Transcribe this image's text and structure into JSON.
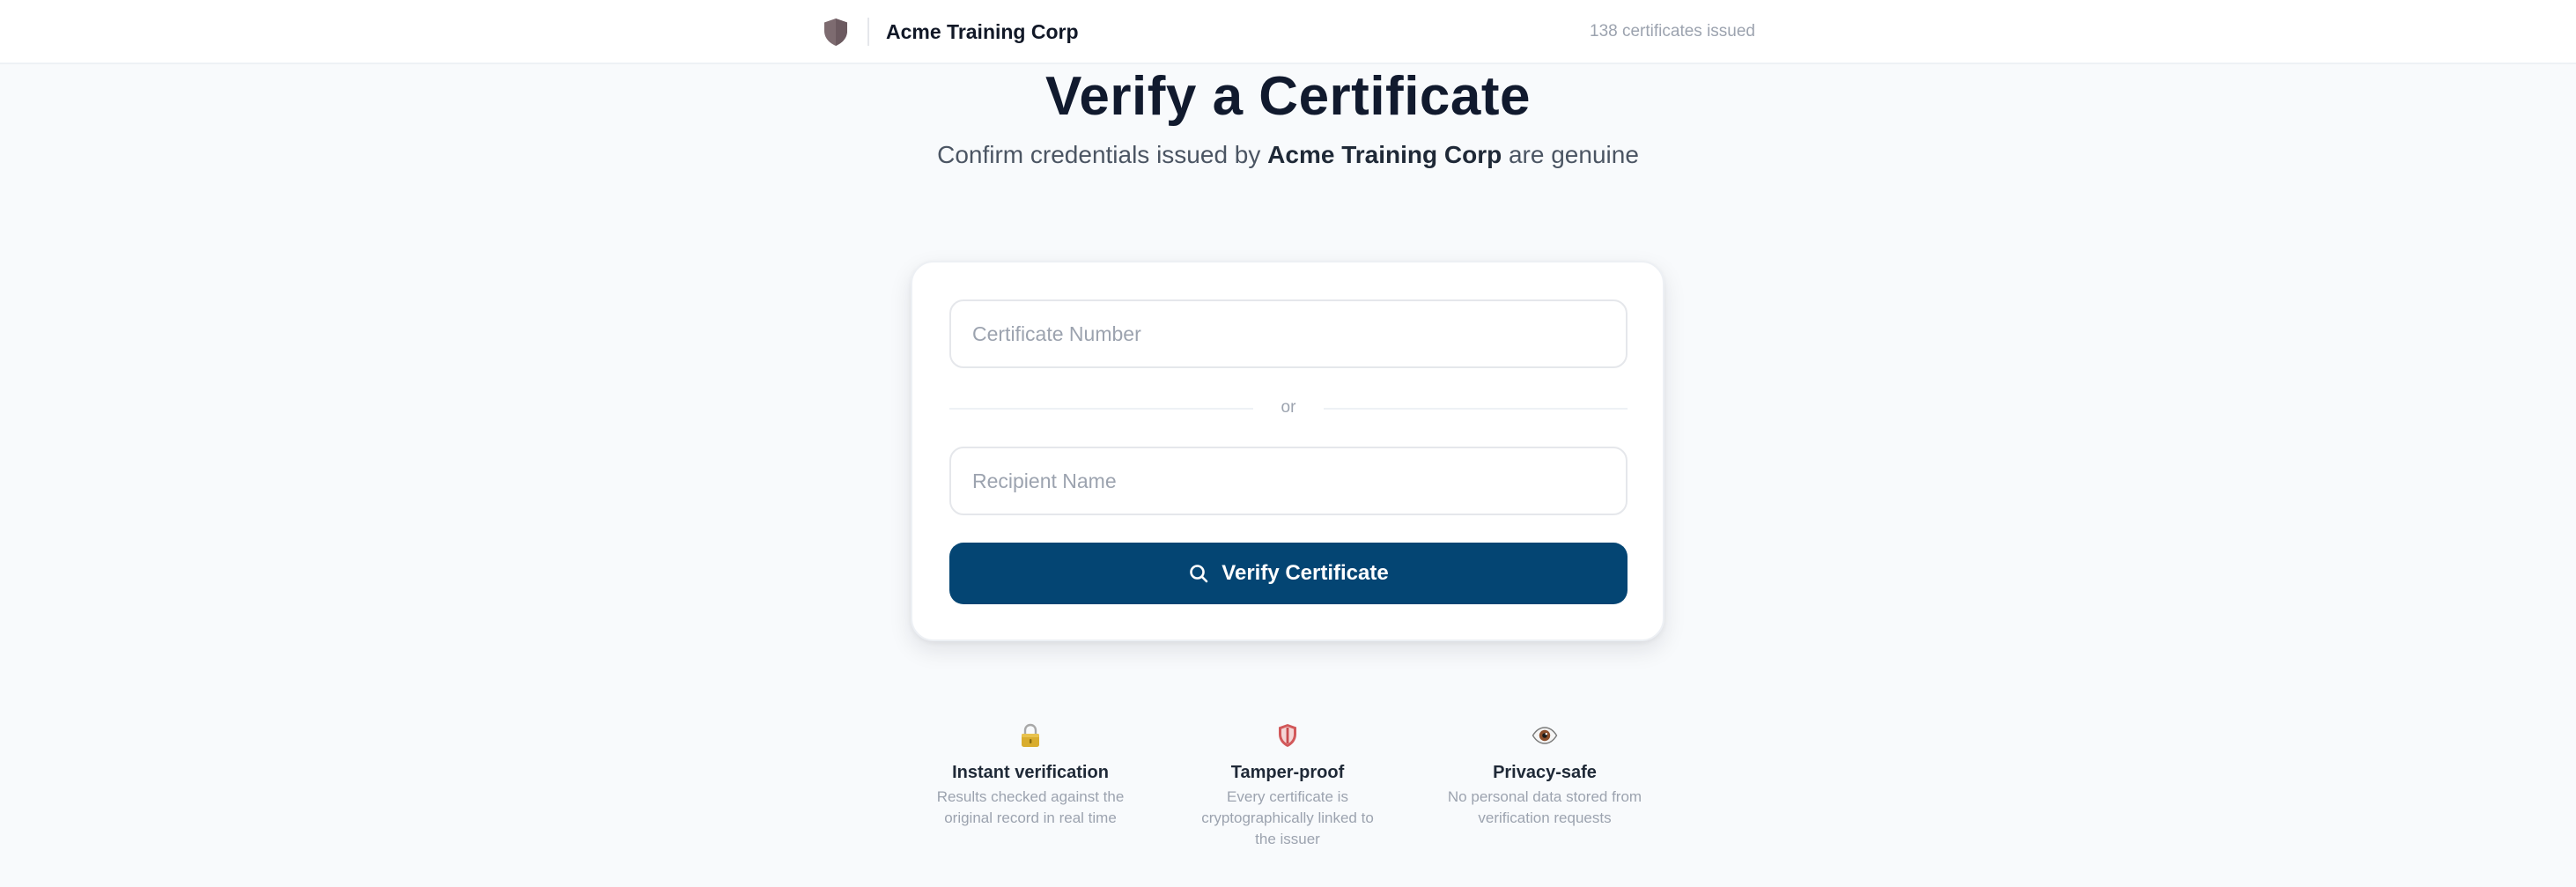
{
  "header": {
    "org_name": "Acme Training Corp",
    "issued_count": "138 certificates issued",
    "logo_icon": "shield-icon"
  },
  "hero": {
    "title": "Verify a Certificate",
    "subtitle_prefix": "Confirm credentials issued by ",
    "subtitle_org": "Acme Training Corp",
    "subtitle_suffix": " are genuine"
  },
  "form": {
    "certificate_number": {
      "placeholder": "Certificate Number",
      "value": ""
    },
    "separator": "or",
    "recipient_name": {
      "placeholder": "Recipient Name",
      "value": ""
    },
    "submit_label": "Verify Certificate",
    "submit_icon": "search-icon"
  },
  "features": [
    {
      "icon": "lock-icon",
      "title": "Instant verification",
      "description": "Results checked against the original record in real time"
    },
    {
      "icon": "shield-icon",
      "title": "Tamper-proof",
      "description": "Every certificate is cryptographically linked to the issuer"
    },
    {
      "icon": "eye-icon",
      "title": "Privacy-safe",
      "description": "No personal data stored from verification requests"
    }
  ],
  "colors": {
    "primary": "#044573",
    "background": "#f8fafc",
    "logo_shield": "#7d6b70"
  }
}
